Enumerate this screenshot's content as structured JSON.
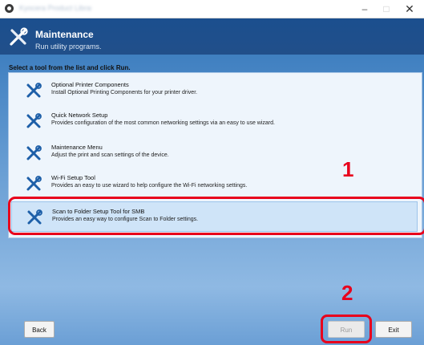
{
  "window": {
    "title": "Kyocera Product Library",
    "controls": {
      "minimize": "–",
      "maximize": "□",
      "close": "✕"
    }
  },
  "header": {
    "title": "Maintenance",
    "subtitle": "Run utility programs.",
    "icon": "tools-icon"
  },
  "instruction": "Select a tool from the list and click Run.",
  "tools": [
    {
      "name": "Optional Printer Components",
      "description": "Install Optional Printing Components for your printer driver.",
      "icon": "tools-icon"
    },
    {
      "name": "Quick Network Setup",
      "description": "Provides configuration of the most common networking settings via an easy to use wizard.",
      "icon": "tools-icon"
    },
    {
      "name": "Maintenance Menu",
      "description": "Adjust the print and scan settings of the device.",
      "icon": "tools-icon"
    },
    {
      "name": "Wi-Fi Setup Tool",
      "description": "Provides an easy to use wizard to help configure the Wi-Fi networking settings.",
      "icon": "tools-icon"
    },
    {
      "name": "Scan to Folder Setup Tool for SMB",
      "description": "Provides an easy way to configure Scan to Folder settings.",
      "icon": "tools-icon",
      "selected": true
    }
  ],
  "callouts": {
    "step1": "1",
    "step2": "2"
  },
  "buttons": {
    "back": "Back",
    "run": "Run",
    "exit": "Exit"
  },
  "colors": {
    "accent": "#e8001c",
    "header": "#1b4f8e",
    "icon": "#1d5fa8"
  }
}
